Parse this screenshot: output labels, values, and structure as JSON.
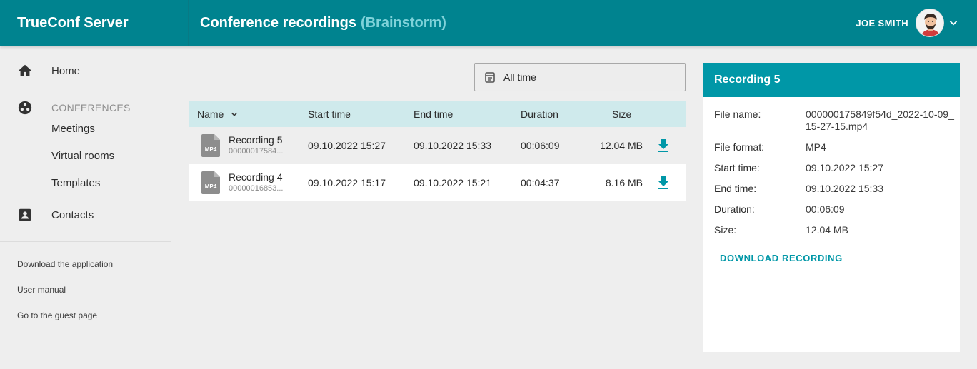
{
  "header": {
    "app_title": "TrueConf Server",
    "page_title": "Conference recordings",
    "page_subtitle": "(Brainstorm)",
    "user_name": "JOE SMITH",
    "accent_color": "#00838f"
  },
  "sidebar": {
    "home": "Home",
    "conferences_label": "CONFERENCES",
    "meetings": "Meetings",
    "virtual_rooms": "Virtual rooms",
    "templates": "Templates",
    "contacts": "Contacts",
    "download_app": "Download the application",
    "user_manual": "User manual",
    "guest_page": "Go to the guest page"
  },
  "filter": {
    "value": "All time",
    "icon": "calendar-icon"
  },
  "table": {
    "columns": [
      "Name",
      "Start time",
      "End time",
      "Duration",
      "Size"
    ],
    "rows": [
      {
        "format": "MP4",
        "name": "Recording 5",
        "file": "00000017584...",
        "start": "09.10.2022 15:27",
        "end": "09.10.2022 15:33",
        "duration": "00:06:09",
        "size": "12.04 MB"
      },
      {
        "format": "MP4",
        "name": "Recording 4",
        "file": "00000016853...",
        "start": "09.10.2022 15:17",
        "end": "09.10.2022 15:21",
        "duration": "00:04:37",
        "size": "8.16 MB"
      }
    ]
  },
  "details": {
    "title": "Recording 5",
    "file_name_label": "File name:",
    "file_name": "000000175849f54d_2022-10-09_15-27-15.mp4",
    "file_format_label": "File format:",
    "file_format": "MP4",
    "start_label": "Start time:",
    "start": "09.10.2022 15:27",
    "end_label": "End time:",
    "end": "09.10.2022 15:33",
    "duration_label": "Duration:",
    "duration": "00:06:09",
    "size_label": "Size:",
    "size": "12.04 MB",
    "download_label": "DOWNLOAD RECORDING"
  }
}
